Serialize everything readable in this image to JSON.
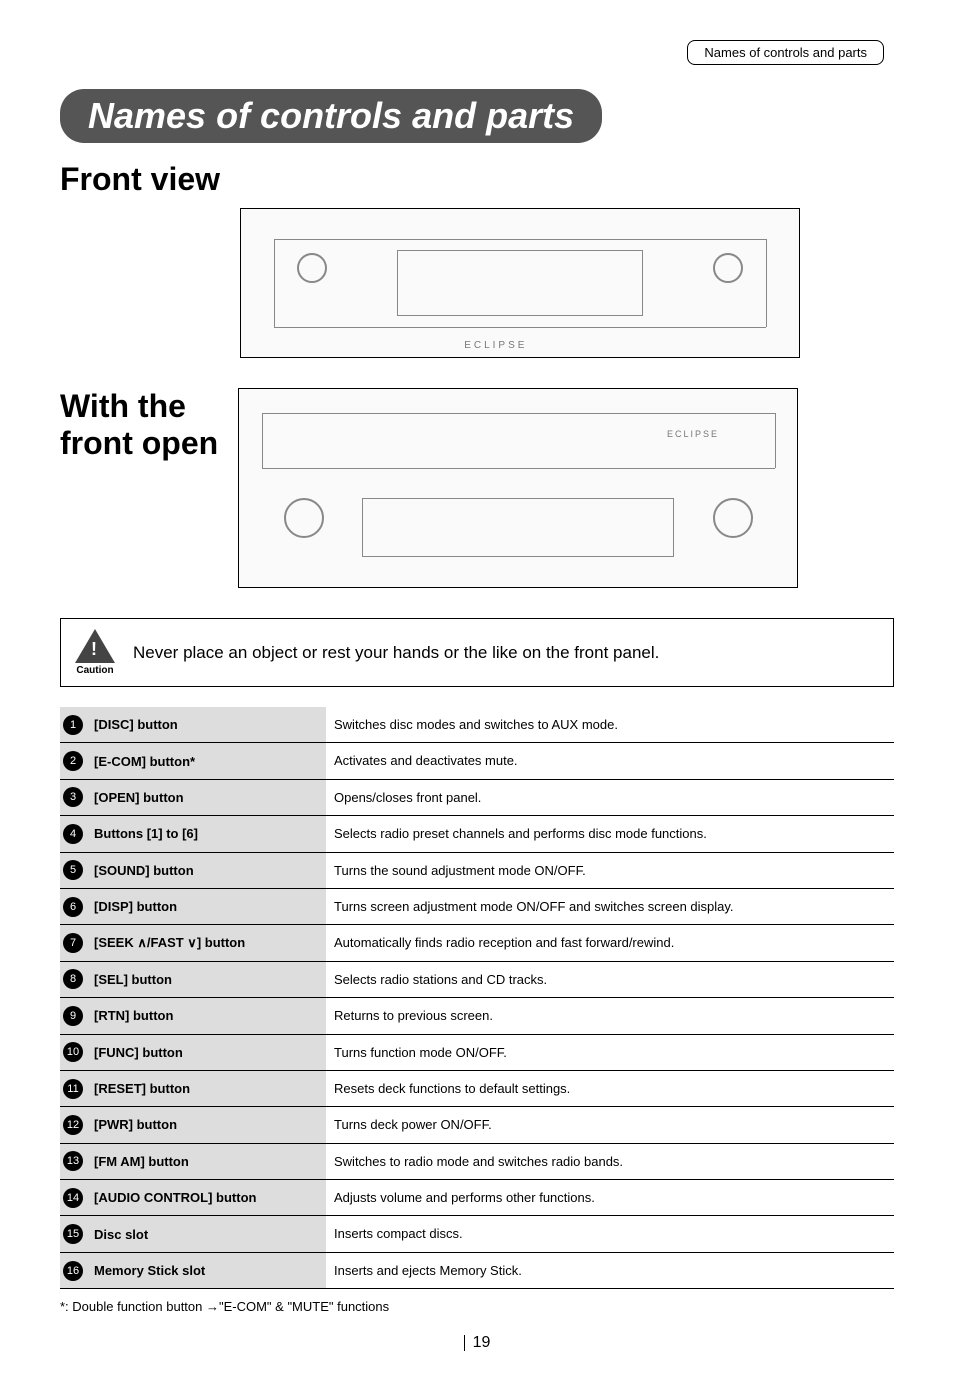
{
  "header_label": "Names of controls and parts",
  "title": "Names of controls and parts",
  "section_front": "Front view",
  "section_open_l1": "With the",
  "section_open_l2": "front open",
  "caution_label": "Caution",
  "caution_text": "Never place an object or rest your hands or the like on the front panel.",
  "rows": [
    {
      "n": "1",
      "name": "[DISC] button",
      "desc": "Switches disc modes and switches to AUX mode."
    },
    {
      "n": "2",
      "name": "[E-COM] button*",
      "desc": "Activates and deactivates mute."
    },
    {
      "n": "3",
      "name": "[OPEN] button",
      "desc": "Opens/closes front panel."
    },
    {
      "n": "4",
      "name": "Buttons [1] to [6]",
      "desc": "Selects radio preset channels and performs disc mode functions."
    },
    {
      "n": "5",
      "name": "[SOUND] button",
      "desc": "Turns the sound adjustment mode ON/OFF."
    },
    {
      "n": "6",
      "name": "[DISP] button",
      "desc": "Turns screen adjustment mode ON/OFF and switches screen display."
    },
    {
      "n": "7",
      "name": "[SEEK ∧/FAST ∨] button",
      "desc": "Automatically finds radio reception and fast forward/rewind."
    },
    {
      "n": "8",
      "name": "[SEL] button",
      "desc": "Selects radio stations and CD tracks."
    },
    {
      "n": "9",
      "name": "[RTN] button",
      "desc": "Returns to previous screen."
    },
    {
      "n": "10",
      "name": "[FUNC] button",
      "desc": "Turns function mode ON/OFF."
    },
    {
      "n": "11",
      "name": "[RESET] button",
      "desc": "Resets deck functions to default settings."
    },
    {
      "n": "12",
      "name": "[PWR] button",
      "desc": "Turns deck power ON/OFF."
    },
    {
      "n": "13",
      "name": "[FM AM] button",
      "desc": "Switches to radio mode and switches radio bands."
    },
    {
      "n": "14",
      "name": "[AUDIO CONTROL] button",
      "desc": "Adjusts volume and performs other functions."
    },
    {
      "n": "15",
      "name": "Disc slot",
      "desc": "Inserts compact discs."
    },
    {
      "n": "16",
      "name": "Memory Stick slot",
      "desc": "Inserts and ejects Memory Stick."
    }
  ],
  "footnote": "*: Double function button  →\"E-COM\" & \"MUTE\" functions",
  "page": "19"
}
